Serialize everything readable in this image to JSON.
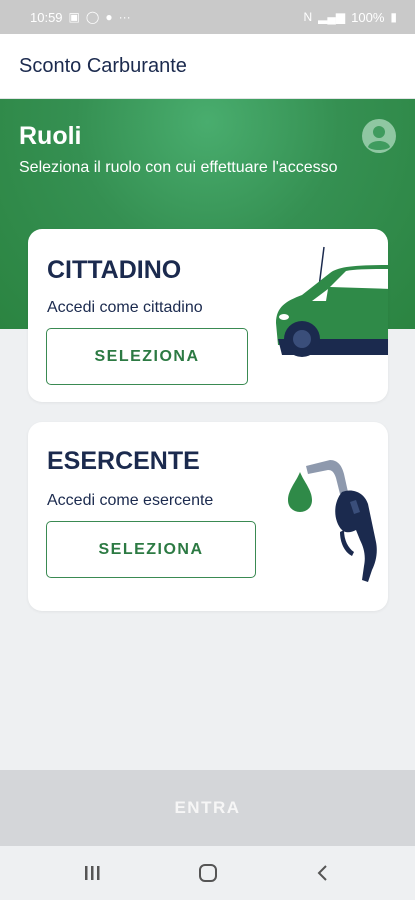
{
  "status_bar": {
    "time": "10:59",
    "battery": "100%"
  },
  "app_bar": {
    "title": "Sconto Carburante"
  },
  "header": {
    "title": "Ruoli",
    "subtitle": "Seleziona il ruolo con cui effettuare l'accesso",
    "profile_icon": "account-circle-icon"
  },
  "roles": [
    {
      "title": "CITTADINO",
      "description": "Accedi come cittadino",
      "button_label": "SELEZIONA",
      "illustration": "car-icon"
    },
    {
      "title": "ESERCENTE",
      "description": "Accedi come esercente",
      "button_label": "SELEZIONA",
      "illustration": "fuel-nozzle-icon"
    }
  ],
  "footer": {
    "enter_label": "ENTRA"
  },
  "colors": {
    "brand_green": "#359052",
    "navy": "#1b2a4e",
    "button_disabled": "#d4d6d9"
  }
}
